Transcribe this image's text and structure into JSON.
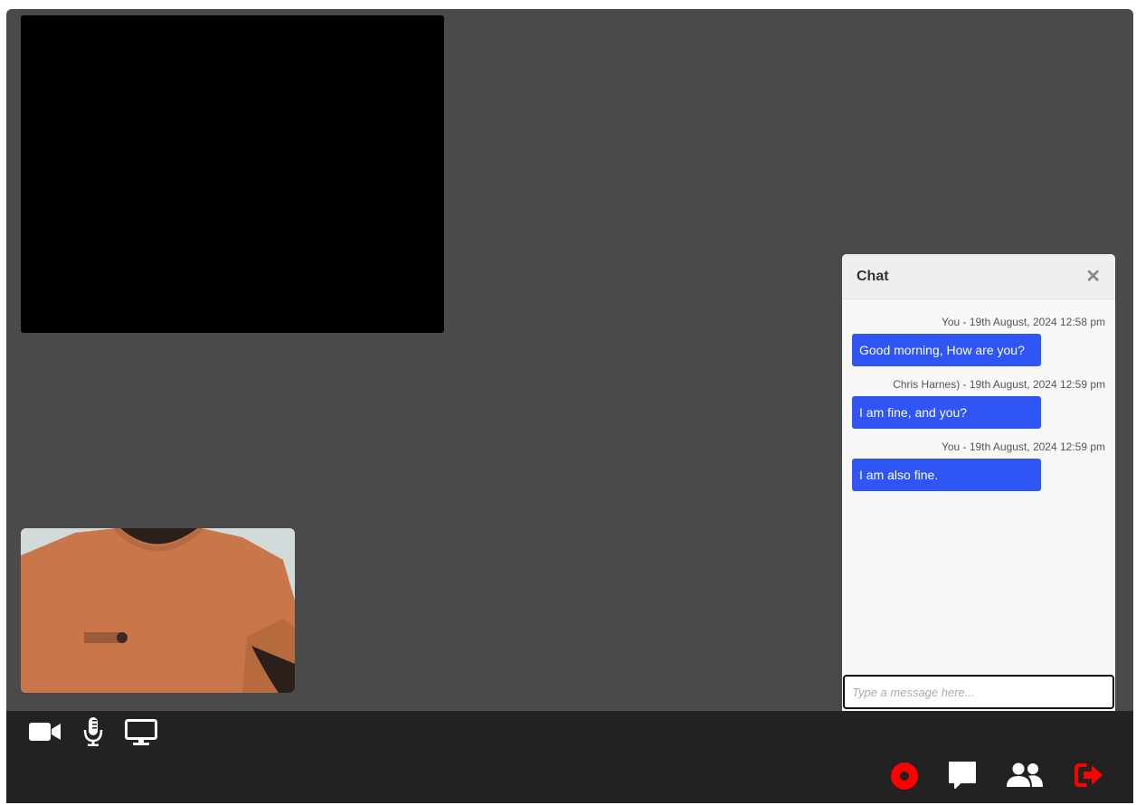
{
  "chat": {
    "title": "Chat",
    "close_icon": "close-icon",
    "messages": [
      {
        "meta": "You - 19th August, 2024 12:58 pm",
        "text": "Good morning, How are you?"
      },
      {
        "meta": "Chris Harnes) - 19th August, 2024 12:59 pm",
        "text": "I am fine, and you?"
      },
      {
        "meta": "You - 19th August, 2024 12:59 pm",
        "text": "I am also fine."
      }
    ],
    "input": {
      "placeholder": "Type a message here...",
      "value": ""
    },
    "bubble_color": "#2f55f5"
  },
  "controls": {
    "left": [
      "video-camera-icon",
      "microphone-icon",
      "screen-share-icon"
    ],
    "right": [
      "record-icon",
      "chat-icon",
      "participants-icon",
      "leave-call-icon"
    ],
    "record_color": "#ff0000",
    "leave_color": "#ff0000"
  },
  "colors": {
    "stage_bg": "#4a4a4a",
    "control_bar_bg": "#222222"
  }
}
